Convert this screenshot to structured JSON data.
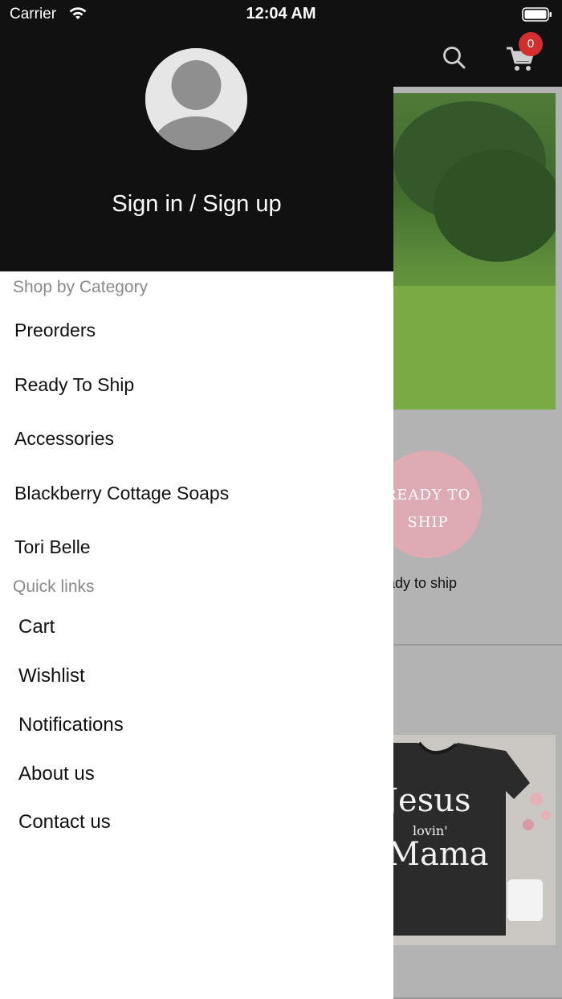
{
  "status_bar": {
    "carrier": "Carrier",
    "time": "12:04 AM"
  },
  "header": {
    "cart_count": "0"
  },
  "background": {
    "ready_circle_text": [
      "READY TO",
      "SHIP"
    ],
    "ready_caption": "eady to ship",
    "partial_text": "!",
    "tshirt_text": [
      "Jesus",
      "lovin'",
      "Mama"
    ]
  },
  "drawer": {
    "sign_in_label": "Sign in / Sign up",
    "category_title": "Shop by Category",
    "categories": [
      "Preorders",
      "Ready To Ship",
      "Accessories",
      "Blackberry Cottage Soaps",
      "Tori Belle"
    ],
    "quick_links_title": "Quick links",
    "quick_links": [
      "Cart",
      "Wishlist",
      "Notifications",
      "About us",
      "Contact us"
    ]
  },
  "colors": {
    "header_bg": "#111111",
    "badge": "#d32f2f",
    "section_title": "#8a8a8a",
    "overlay": "#b3b3b3"
  },
  "icons": [
    "wifi-icon",
    "battery-icon",
    "search-icon",
    "cart-icon",
    "avatar-icon"
  ]
}
